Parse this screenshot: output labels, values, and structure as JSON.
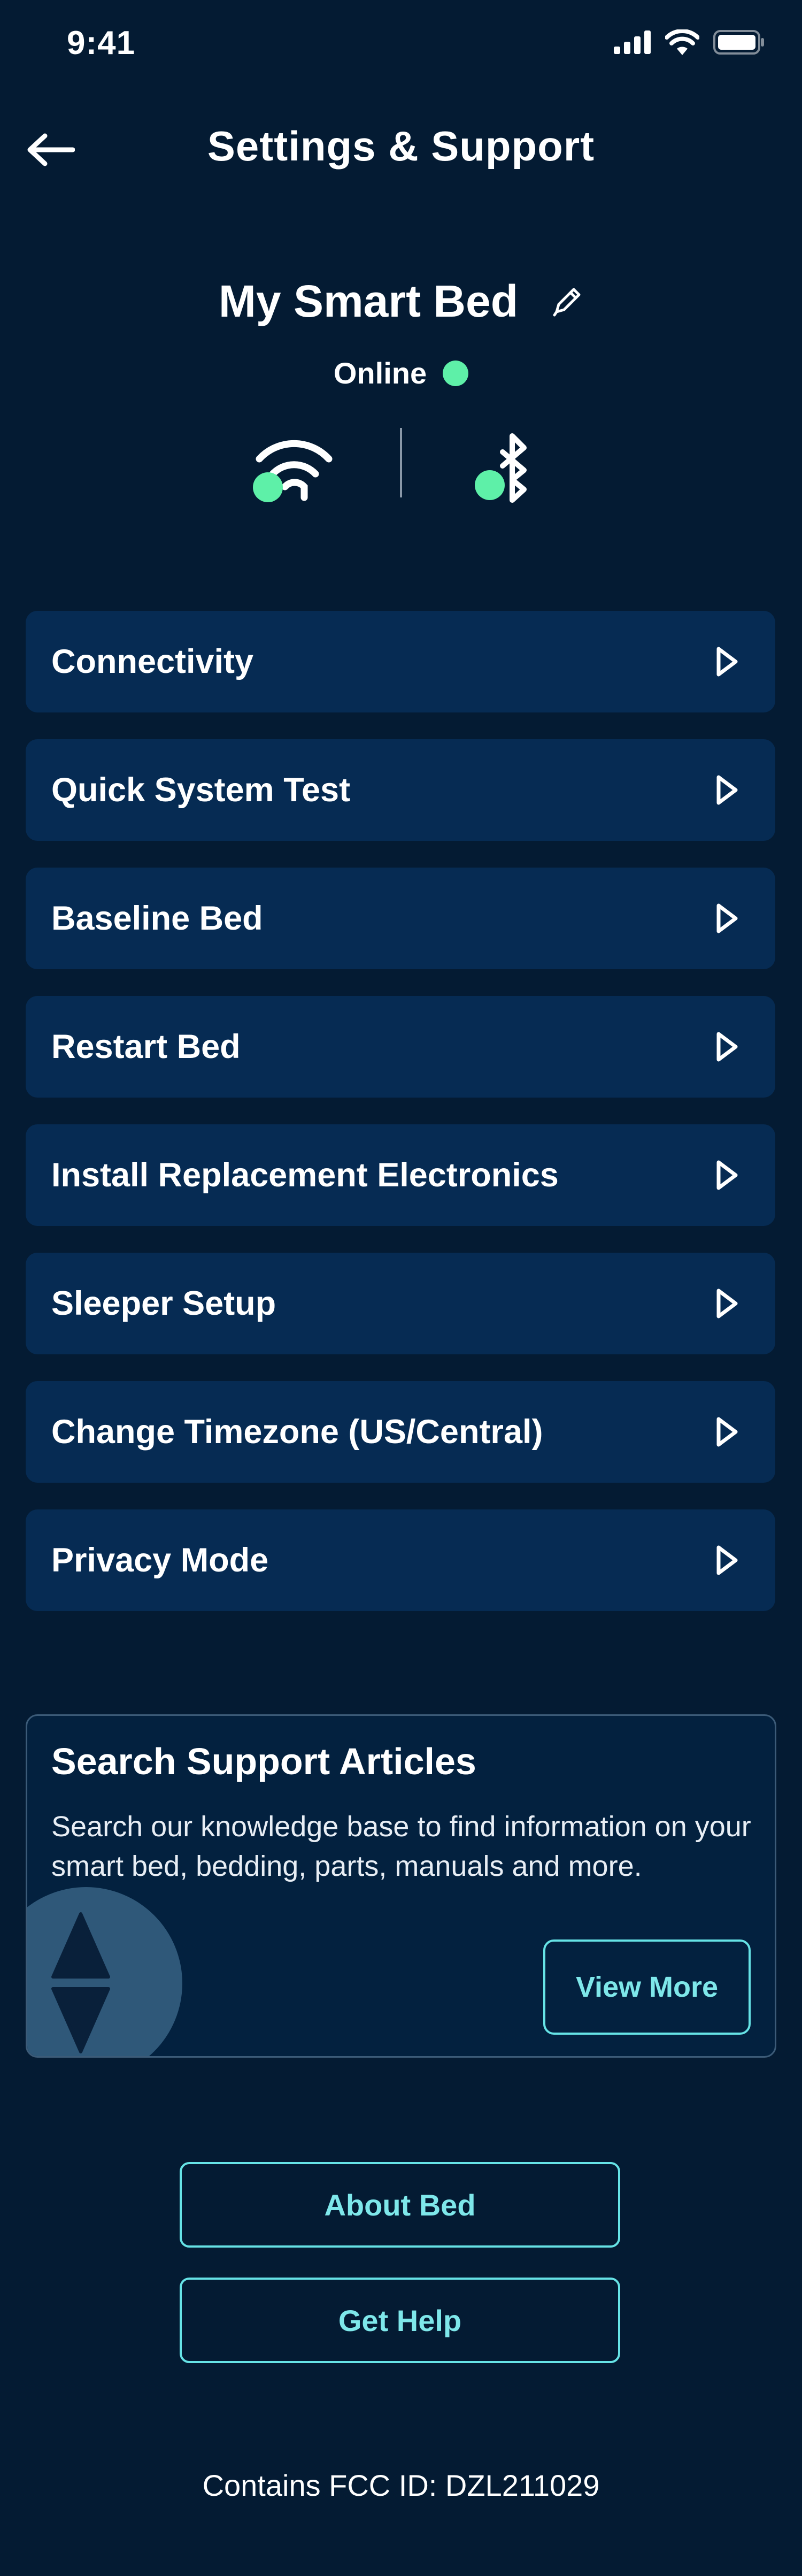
{
  "status_bar": {
    "time": "9:41",
    "icons": [
      "cellular-signal-icon",
      "wifi-icon",
      "battery-icon"
    ]
  },
  "header": {
    "title": "Settings & Support",
    "back_icon": "arrow-left-icon"
  },
  "bed": {
    "name": "My Smart Bed",
    "status": "Online",
    "status_color": "#5ef0a8",
    "connections": [
      "wifi-icon",
      "bluetooth-icon"
    ]
  },
  "menu": {
    "items": [
      {
        "label": "Connectivity"
      },
      {
        "label": "Quick System Test"
      },
      {
        "label": "Baseline Bed"
      },
      {
        "label": "Restart Bed"
      },
      {
        "label": "Install Replacement Electronics"
      },
      {
        "label": "Sleeper Setup"
      },
      {
        "label": "Change Timezone (US/Central)"
      },
      {
        "label": "Privacy Mode"
      }
    ]
  },
  "support": {
    "title": "Search Support Articles",
    "description": "Search our knowledge base to find information on your smart bed, bedding, parts, manuals and more.",
    "view_more_label": "View More"
  },
  "actions": {
    "about_label": "About Bed",
    "help_label": "Get Help"
  },
  "footer": {
    "fcc": "Contains FCC ID: DZL211029"
  },
  "colors": {
    "background": "#041b33",
    "card": "#062b53",
    "accent": "#66e3e6"
  }
}
